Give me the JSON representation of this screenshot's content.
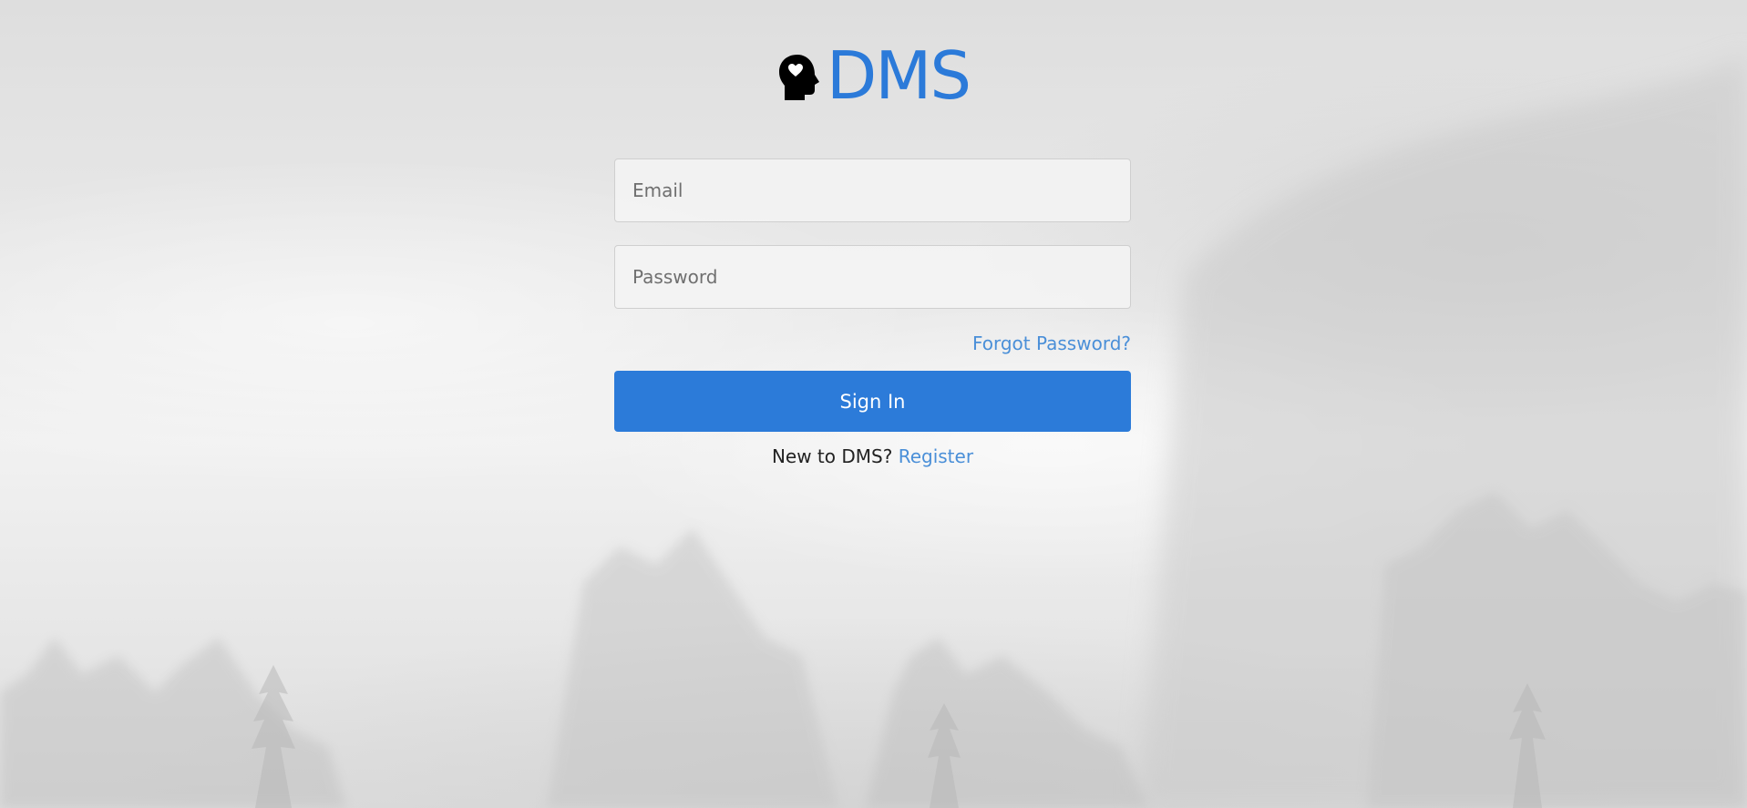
{
  "brand": {
    "name": "DMS",
    "icon": "head-heart-icon",
    "color": "#2b7ad9"
  },
  "login": {
    "email_placeholder": "Email",
    "email_value": "",
    "password_placeholder": "Password",
    "password_value": "",
    "forgot_label": "Forgot Password?",
    "signin_label": "Sign In",
    "signin_color": "#2c7bd9",
    "register_prompt": "New to DMS?",
    "register_label": "Register",
    "link_color": "#4a8fd8"
  }
}
